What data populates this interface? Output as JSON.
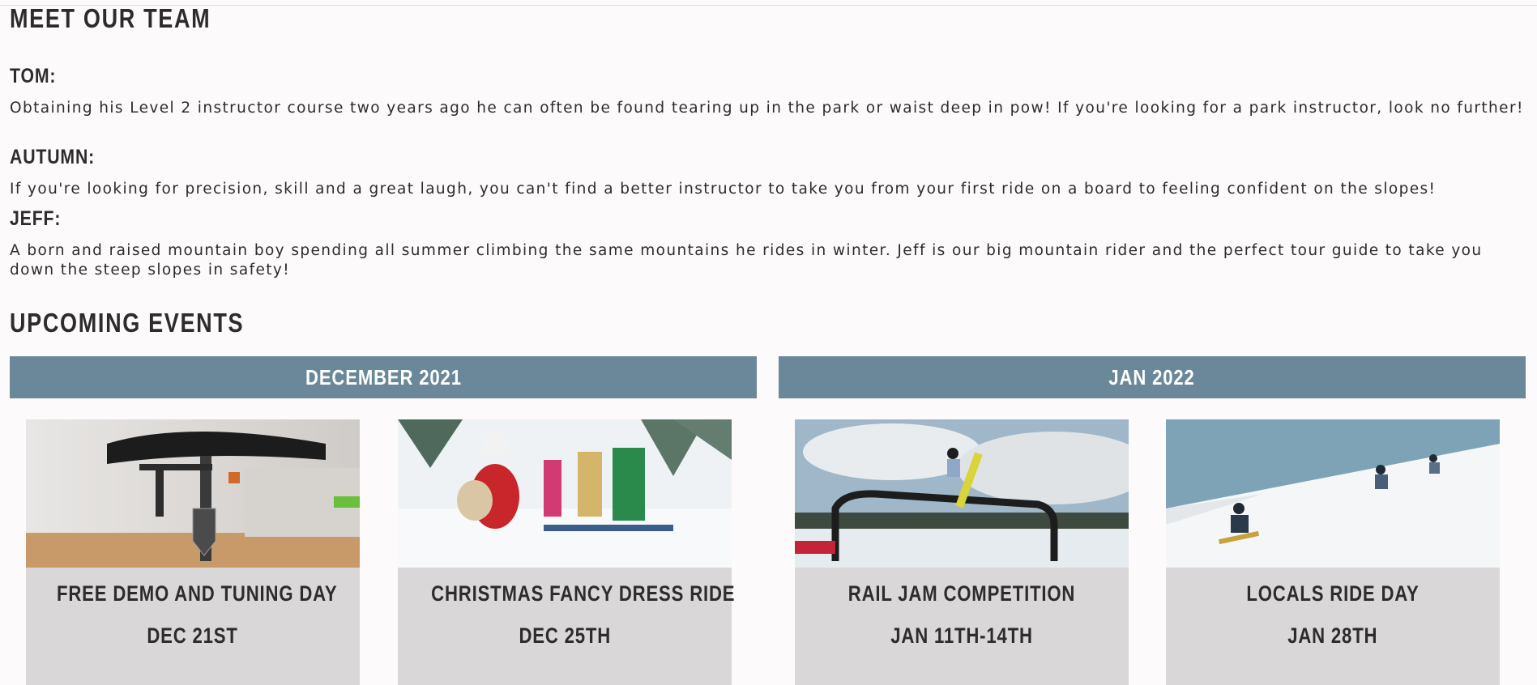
{
  "team": {
    "heading": "MEET OUR TEAM",
    "members": [
      {
        "name": "TOM:",
        "bio": "Obtaining his Level 2 instructor course two years ago he can often be found tearing up in the park or waist deep in pow! If you're looking for a park instructor, look no further!"
      },
      {
        "name": "AUTUMN:",
        "bio": "If you're looking for precision, skill and a great laugh, you can't find a better instructor to take you from your first ride on a board to feeling confident on the slopes!"
      },
      {
        "name": "JEFF:",
        "bio": "A born and raised mountain boy spending all summer climbing the same mountains he rides in winter. Jeff is our big mountain rider and the perfect tour guide to take you down the steep slopes in safety!"
      }
    ]
  },
  "events": {
    "heading": "UPCOMING EVENTS",
    "months": [
      "DECEMBER 2021",
      "JAN 2022"
    ],
    "cards": [
      {
        "title": "FREE DEMO AND TUNING DAY",
        "date": "DEC 21ST",
        "image": "snowboard-binding-photo"
      },
      {
        "title": "CHRISTMAS FANCY DRESS RIDE",
        "date": "DEC 25TH",
        "image": "costumed-riders-photo"
      },
      {
        "title": "RAIL JAM COMPETITION",
        "date": "JAN 11TH-14TH",
        "image": "rail-jump-photo"
      },
      {
        "title": "LOCALS RIDE DAY",
        "date": "JAN 28TH",
        "image": "riders-on-slope-photo"
      }
    ]
  },
  "colors": {
    "month_bar": "#6a8899",
    "card_bg": "#d9d7d8",
    "text": "#2e2b2b",
    "page_bg": "#fcfafa"
  }
}
